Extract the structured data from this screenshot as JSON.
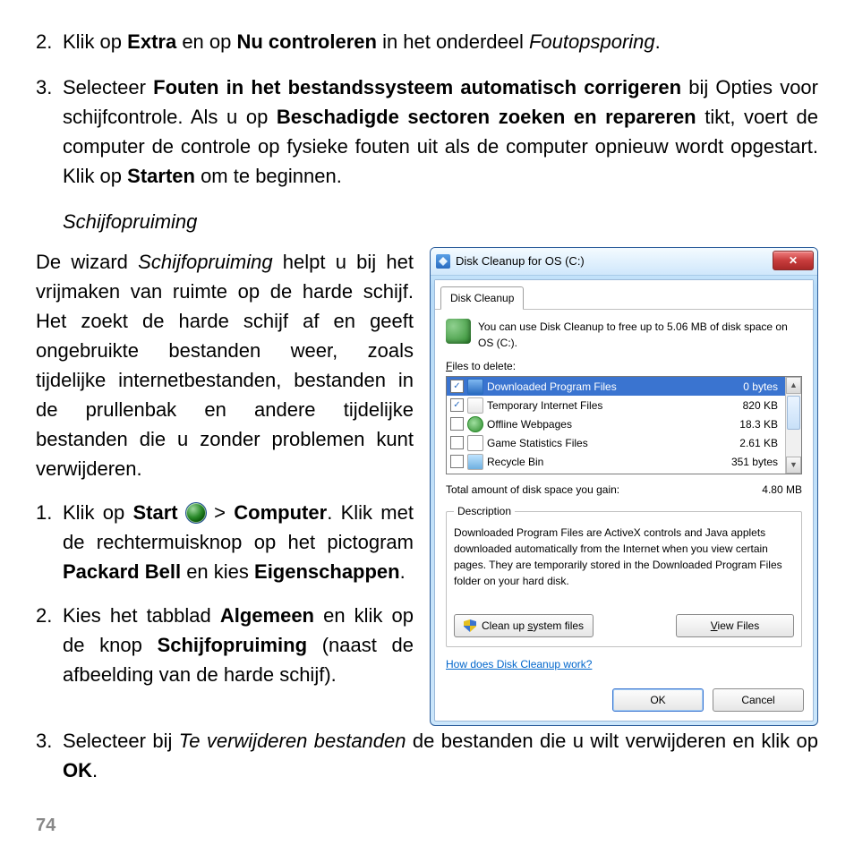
{
  "steps_top": {
    "step2": {
      "prefix": "Klik op ",
      "b1": "Extra",
      "mid": " en op ",
      "b2": "Nu controleren",
      "mid2": " in het onderdeel ",
      "i1": "Foutopsporing",
      "end": "."
    },
    "step3": {
      "t1": "Selecteer ",
      "b1": "Fouten in het bestandssysteem automatisch corrigeren",
      "t2": " bij Opties voor schijfcontrole. Als u op ",
      "b2": "Beschadigde sectoren zoeken en repareren",
      "t3": " tikt, voert de computer de controle op fysieke fouten uit als de computer opnieuw wordt opgestart. Klik op ",
      "b3": "Starten",
      "t4": " om te beginnen."
    }
  },
  "subheading": "Schijfopruiming",
  "para_left": {
    "t1": "De wizard ",
    "i1": "Schijfopruiming",
    "t2": " helpt u bij het vrijmaken van ruimte op de harde schijf. Het zoekt de harde schijf af en geeft ongebruikte bestanden weer, zoals tijdelijke internetbestanden, bestanden in de prullenbak en andere tijdelijke bestanden die u zonder problemen kunt verwijderen."
  },
  "sub_steps": {
    "s1": {
      "t1": "Klik op ",
      "b1": "Start",
      "t2": "  >  ",
      "b2": "Computer",
      "t3": ". Klik met de rechtermuisknop op het pictogram ",
      "b3": "Packard Bell",
      "t4": " en kies ",
      "b4": "Eigenschappen",
      "t5": "."
    },
    "s2": {
      "t1": "Kies het tabblad ",
      "b1": "Algemeen",
      "t2": " en klik op de knop ",
      "b2": "Schijfopruiming",
      "t3": " (naast de afbeelding van de harde schijf)."
    },
    "s3": {
      "t1": "Selecteer bij ",
      "i1": "Te verwijderen bestanden",
      "t2": " de bestanden die u wilt verwijderen en klik op ",
      "b1": "OK",
      "t3": "."
    }
  },
  "page_number": "74",
  "dialog": {
    "title": "Disk Cleanup for OS (C:)",
    "close": "✕",
    "tab": "Disk Cleanup",
    "intro": "You can use Disk Cleanup to free up to 5.06 MB of disk space on OS (C:).",
    "files_label_pre": "F",
    "files_label_rest": "iles to delete:",
    "rows": [
      {
        "checked": true,
        "sel": true,
        "icon": "blue",
        "name": "Downloaded Program Files",
        "size": "0 bytes"
      },
      {
        "checked": true,
        "sel": false,
        "icon": "page",
        "name": "Temporary Internet Files",
        "size": "820 KB"
      },
      {
        "checked": false,
        "sel": false,
        "icon": "globe",
        "name": "Offline Webpages",
        "size": "18.3 KB"
      },
      {
        "checked": false,
        "sel": false,
        "icon": "dice",
        "name": "Game Statistics Files",
        "size": "2.61 KB"
      },
      {
        "checked": false,
        "sel": false,
        "icon": "bin",
        "name": "Recycle Bin",
        "size": "351 bytes"
      }
    ],
    "total_label": "Total amount of disk space you gain:",
    "total_value": "4.80 MB",
    "desc_legend": "Description",
    "desc_text": "Downloaded Program Files are ActiveX controls and Java applets downloaded automatically from the Internet when you view certain pages. They are temporarily stored in the Downloaded Program Files folder on your hard disk.",
    "btn_cleanup_pre": "Clean up ",
    "btn_cleanup_u": "s",
    "btn_cleanup_post": "ystem files",
    "btn_viewfiles_u": "V",
    "btn_viewfiles_post": "iew Files",
    "help_link": "How does Disk Cleanup work?",
    "ok": "OK",
    "cancel": "Cancel"
  }
}
